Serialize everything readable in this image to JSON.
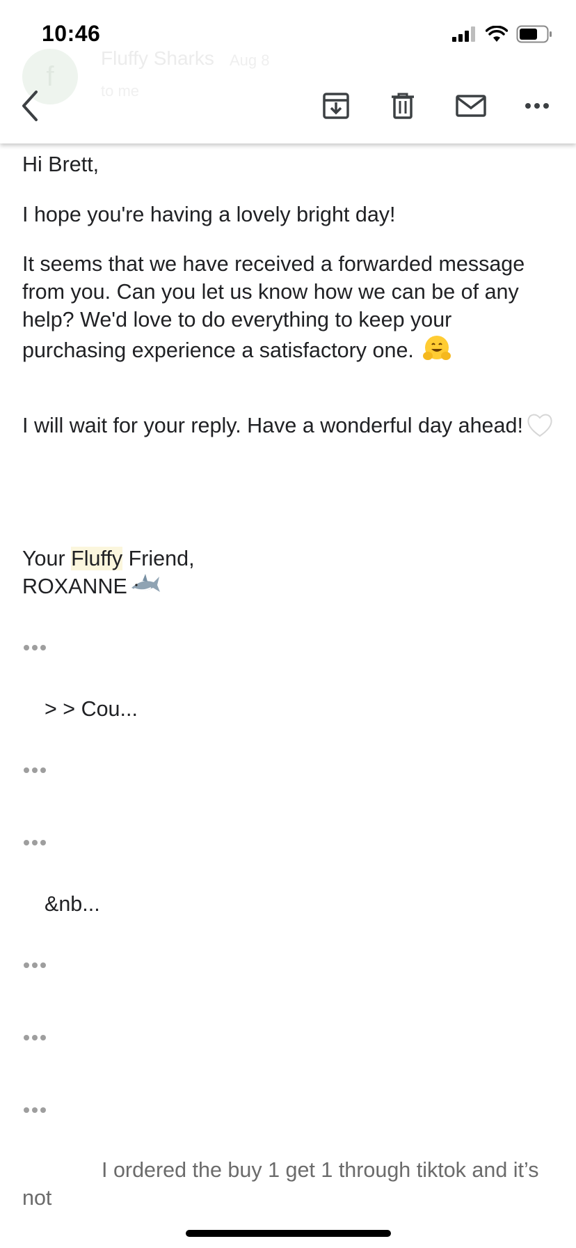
{
  "status_bar": {
    "time": "10:46"
  },
  "header": {
    "sender": "Fluffy Sharks",
    "date": "Aug 8",
    "recipient": "to me",
    "avatar_letter": "f"
  },
  "icons": {
    "back": "chevron-left-icon",
    "archive": "archive-icon",
    "delete": "trash-icon",
    "mark_unread": "mail-icon",
    "more": "more-horizontal-icon"
  },
  "body": {
    "greeting": "Hi Brett,",
    "line1": "I hope you're having a lovely bright day!",
    "para2": "It seems that we have received a forwarded message from you. Can you let us know how we can be of any help? We'd love to do everything to keep your purchasing experience a satisfactory one.",
    "para3": "I will wait for your reply. Have a wonderful day ahead!",
    "sign_prefix": "Your ",
    "sign_highlight": "Fluffy",
    "sign_suffix": " Friend,",
    "signature_name": "ROXANNE"
  },
  "quoted": {
    "snippet1": "> > Cou...",
    "snippet2": "&nb..."
  },
  "preview_text": "I ordered the buy 1 get 1 through tiktok and it’s not",
  "colors": {
    "highlight": "#fbf6dd",
    "text": "#202124",
    "muted": "#6b6b6b"
  }
}
